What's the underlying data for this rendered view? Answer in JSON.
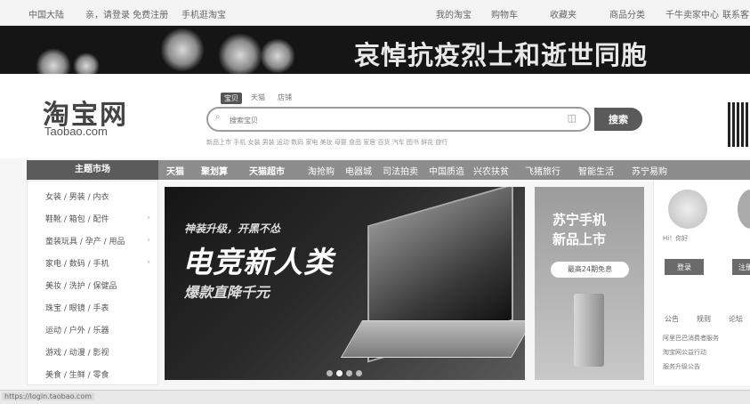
{
  "topbar": {
    "links": [
      "中国大陆",
      "亲，请登录 免费注册",
      "手机逛淘宝",
      "我的淘宝",
      "购物车",
      "收藏夹",
      "商品分类",
      "千牛卖家中心",
      "联系客服"
    ]
  },
  "banner": {
    "text": "哀悼抗疫烈士和逝世同胞"
  },
  "logo": {
    "cn": "淘宝网",
    "en": "Taobao.com"
  },
  "search": {
    "tabs": [
      "宝贝",
      "天猫",
      "店铺"
    ],
    "placeholder": "搜索宝贝",
    "button": "搜索",
    "hotwords": "新品上市 手机 女装 男装 运动 数码 家电 美妆 母婴 食品 家居 百货 汽车 图书 鲜花 旅行"
  },
  "nav": {
    "category_header": "主题市场",
    "items": [
      "天猫",
      "聚划算",
      "天猫超市",
      "淘抢购",
      "电器城",
      "司法拍卖",
      "中国质造",
      "兴农扶贫",
      "飞猪旅行",
      "智能生活",
      "苏宁易购"
    ]
  },
  "sidebar": {
    "rows": [
      "女装 / 男装 / 内衣",
      "鞋靴 / 箱包 / 配件",
      "童装玩具 / 孕产 / 用品",
      "家电 / 数码 / 手机",
      "美妆 / 洗护 / 保健品",
      "珠宝 / 眼镜 / 手表",
      "运动 / 户外 / 乐器",
      "游戏 / 动漫 / 影视",
      "美食 / 生鲜 / 零食"
    ]
  },
  "promo": {
    "line1": "神装升级，开黑不怂",
    "title": "电竞新人类",
    "line3": "爆款直降千元"
  },
  "side_promo": {
    "title1": "苏宁手机",
    "title2": "新品上市",
    "button": "最高24期免息"
  },
  "user_panel": {
    "welcome": "Hi！你好",
    "login": "登录",
    "register": "注册",
    "tabs": [
      "公告",
      "规则",
      "论坛"
    ],
    "lines": [
      "阿里巴巴消费者服务",
      "淘宝网公益行动",
      "服务升级公告"
    ]
  },
  "status": {
    "url": "https://login.taobao.com"
  }
}
